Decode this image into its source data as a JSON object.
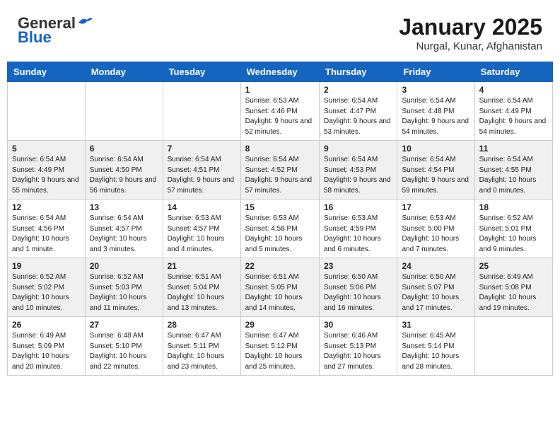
{
  "header": {
    "logo_general": "General",
    "logo_blue": "Blue",
    "title": "January 2025",
    "subtitle": "Nurgal, Kunar, Afghanistan"
  },
  "weekdays": [
    "Sunday",
    "Monday",
    "Tuesday",
    "Wednesday",
    "Thursday",
    "Friday",
    "Saturday"
  ],
  "weeks": [
    [
      {
        "day": "",
        "sunrise": "",
        "sunset": "",
        "daylight": ""
      },
      {
        "day": "",
        "sunrise": "",
        "sunset": "",
        "daylight": ""
      },
      {
        "day": "",
        "sunrise": "",
        "sunset": "",
        "daylight": ""
      },
      {
        "day": "1",
        "sunrise": "Sunrise: 6:53 AM",
        "sunset": "Sunset: 4:46 PM",
        "daylight": "Daylight: 9 hours and 52 minutes."
      },
      {
        "day": "2",
        "sunrise": "Sunrise: 6:54 AM",
        "sunset": "Sunset: 4:47 PM",
        "daylight": "Daylight: 9 hours and 53 minutes."
      },
      {
        "day": "3",
        "sunrise": "Sunrise: 6:54 AM",
        "sunset": "Sunset: 4:48 PM",
        "daylight": "Daylight: 9 hours and 54 minutes."
      },
      {
        "day": "4",
        "sunrise": "Sunrise: 6:54 AM",
        "sunset": "Sunset: 4:49 PM",
        "daylight": "Daylight: 9 hours and 54 minutes."
      }
    ],
    [
      {
        "day": "5",
        "sunrise": "Sunrise: 6:54 AM",
        "sunset": "Sunset: 4:49 PM",
        "daylight": "Daylight: 9 hours and 55 minutes."
      },
      {
        "day": "6",
        "sunrise": "Sunrise: 6:54 AM",
        "sunset": "Sunset: 4:50 PM",
        "daylight": "Daylight: 9 hours and 56 minutes."
      },
      {
        "day": "7",
        "sunrise": "Sunrise: 6:54 AM",
        "sunset": "Sunset: 4:51 PM",
        "daylight": "Daylight: 9 hours and 57 minutes."
      },
      {
        "day": "8",
        "sunrise": "Sunrise: 6:54 AM",
        "sunset": "Sunset: 4:52 PM",
        "daylight": "Daylight: 9 hours and 57 minutes."
      },
      {
        "day": "9",
        "sunrise": "Sunrise: 6:54 AM",
        "sunset": "Sunset: 4:53 PM",
        "daylight": "Daylight: 9 hours and 58 minutes."
      },
      {
        "day": "10",
        "sunrise": "Sunrise: 6:54 AM",
        "sunset": "Sunset: 4:54 PM",
        "daylight": "Daylight: 9 hours and 59 minutes."
      },
      {
        "day": "11",
        "sunrise": "Sunrise: 6:54 AM",
        "sunset": "Sunset: 4:55 PM",
        "daylight": "Daylight: 10 hours and 0 minutes."
      }
    ],
    [
      {
        "day": "12",
        "sunrise": "Sunrise: 6:54 AM",
        "sunset": "Sunset: 4:56 PM",
        "daylight": "Daylight: 10 hours and 1 minute."
      },
      {
        "day": "13",
        "sunrise": "Sunrise: 6:54 AM",
        "sunset": "Sunset: 4:57 PM",
        "daylight": "Daylight: 10 hours and 3 minutes."
      },
      {
        "day": "14",
        "sunrise": "Sunrise: 6:53 AM",
        "sunset": "Sunset: 4:57 PM",
        "daylight": "Daylight: 10 hours and 4 minutes."
      },
      {
        "day": "15",
        "sunrise": "Sunrise: 6:53 AM",
        "sunset": "Sunset: 4:58 PM",
        "daylight": "Daylight: 10 hours and 5 minutes."
      },
      {
        "day": "16",
        "sunrise": "Sunrise: 6:53 AM",
        "sunset": "Sunset: 4:59 PM",
        "daylight": "Daylight: 10 hours and 6 minutes."
      },
      {
        "day": "17",
        "sunrise": "Sunrise: 6:53 AM",
        "sunset": "Sunset: 5:00 PM",
        "daylight": "Daylight: 10 hours and 7 minutes."
      },
      {
        "day": "18",
        "sunrise": "Sunrise: 6:52 AM",
        "sunset": "Sunset: 5:01 PM",
        "daylight": "Daylight: 10 hours and 9 minutes."
      }
    ],
    [
      {
        "day": "19",
        "sunrise": "Sunrise: 6:52 AM",
        "sunset": "Sunset: 5:02 PM",
        "daylight": "Daylight: 10 hours and 10 minutes."
      },
      {
        "day": "20",
        "sunrise": "Sunrise: 6:52 AM",
        "sunset": "Sunset: 5:03 PM",
        "daylight": "Daylight: 10 hours and 11 minutes."
      },
      {
        "day": "21",
        "sunrise": "Sunrise: 6:51 AM",
        "sunset": "Sunset: 5:04 PM",
        "daylight": "Daylight: 10 hours and 13 minutes."
      },
      {
        "day": "22",
        "sunrise": "Sunrise: 6:51 AM",
        "sunset": "Sunset: 5:05 PM",
        "daylight": "Daylight: 10 hours and 14 minutes."
      },
      {
        "day": "23",
        "sunrise": "Sunrise: 6:50 AM",
        "sunset": "Sunset: 5:06 PM",
        "daylight": "Daylight: 10 hours and 16 minutes."
      },
      {
        "day": "24",
        "sunrise": "Sunrise: 6:50 AM",
        "sunset": "Sunset: 5:07 PM",
        "daylight": "Daylight: 10 hours and 17 minutes."
      },
      {
        "day": "25",
        "sunrise": "Sunrise: 6:49 AM",
        "sunset": "Sunset: 5:08 PM",
        "daylight": "Daylight: 10 hours and 19 minutes."
      }
    ],
    [
      {
        "day": "26",
        "sunrise": "Sunrise: 6:49 AM",
        "sunset": "Sunset: 5:09 PM",
        "daylight": "Daylight: 10 hours and 20 minutes."
      },
      {
        "day": "27",
        "sunrise": "Sunrise: 6:48 AM",
        "sunset": "Sunset: 5:10 PM",
        "daylight": "Daylight: 10 hours and 22 minutes."
      },
      {
        "day": "28",
        "sunrise": "Sunrise: 6:47 AM",
        "sunset": "Sunset: 5:11 PM",
        "daylight": "Daylight: 10 hours and 23 minutes."
      },
      {
        "day": "29",
        "sunrise": "Sunrise: 6:47 AM",
        "sunset": "Sunset: 5:12 PM",
        "daylight": "Daylight: 10 hours and 25 minutes."
      },
      {
        "day": "30",
        "sunrise": "Sunrise: 6:46 AM",
        "sunset": "Sunset: 5:13 PM",
        "daylight": "Daylight: 10 hours and 27 minutes."
      },
      {
        "day": "31",
        "sunrise": "Sunrise: 6:45 AM",
        "sunset": "Sunset: 5:14 PM",
        "daylight": "Daylight: 10 hours and 28 minutes."
      },
      {
        "day": "",
        "sunrise": "",
        "sunset": "",
        "daylight": ""
      }
    ]
  ]
}
